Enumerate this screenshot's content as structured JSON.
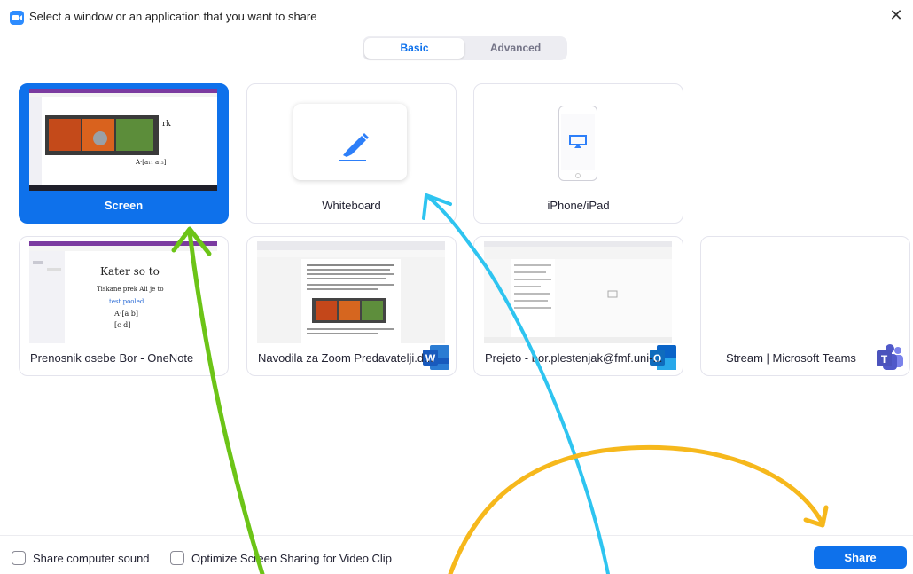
{
  "window": {
    "title": "Select a window or an application that you want to share",
    "close_glyph": "✕"
  },
  "tabs": [
    {
      "label": "Basic",
      "selected": true
    },
    {
      "label": "Advanced",
      "selected": false
    }
  ],
  "cards": {
    "screen": {
      "label": "Screen",
      "selected": true
    },
    "whiteboard": {
      "label": "Whiteboard",
      "icon": "pen-icon"
    },
    "iphone": {
      "label": "iPhone/iPad",
      "icon": "airplay-icon"
    },
    "onenote": {
      "label": "Prenosnik osebe Bor - OneNote"
    },
    "word": {
      "label": "Navodila za Zoom Predavatelji.d...",
      "badge": "W"
    },
    "outlook": {
      "label": "Prejeto - bor.plestenjak@fmf.uni-...",
      "badge": "O"
    },
    "teams": {
      "label": "Stream | Microsoft Teams",
      "badge": "T"
    }
  },
  "footer": {
    "share_sound_label": "Share computer sound",
    "optimize_label": "Optimize Screen Sharing for Video Clip",
    "share_button": "Share"
  },
  "colors": {
    "accent": "#0e71eb",
    "arrow_green": "#6cc417",
    "arrow_blue": "#2ec4f0",
    "arrow_orange": "#f6b81c"
  }
}
